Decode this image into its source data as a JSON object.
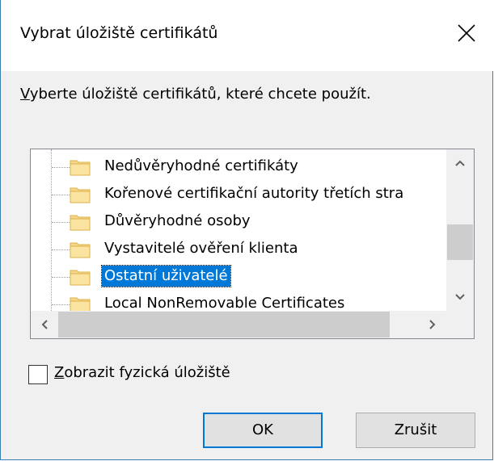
{
  "dialog": {
    "title": "Vybrat úložiště certifikátů",
    "instruction_first_char": "V",
    "instruction_rest": "yberte úložiště certifikátů, které chcete použít."
  },
  "tree": {
    "items": [
      {
        "label": "Nedůvěryhodné certifikáty",
        "selected": false
      },
      {
        "label": "Kořenové certifikační autority třetích stra",
        "selected": false
      },
      {
        "label": "Důvěryhodné osoby",
        "selected": false
      },
      {
        "label": "Vystavitelé ověření klienta",
        "selected": false
      },
      {
        "label": "Ostatní uživatelé",
        "selected": true
      },
      {
        "label": "Local NonRemovable Certificates",
        "selected": false
      }
    ]
  },
  "options": {
    "show_physical_first_char": "Z",
    "show_physical_rest": "obrazit fyzická úložiště",
    "show_physical_checked": false
  },
  "buttons": {
    "ok_label": "OK",
    "cancel_label": "Zrušit"
  },
  "colors": {
    "accent": "#0078d7",
    "folder": "#f6d78a",
    "dialog_bg": "#f0f0f0"
  }
}
